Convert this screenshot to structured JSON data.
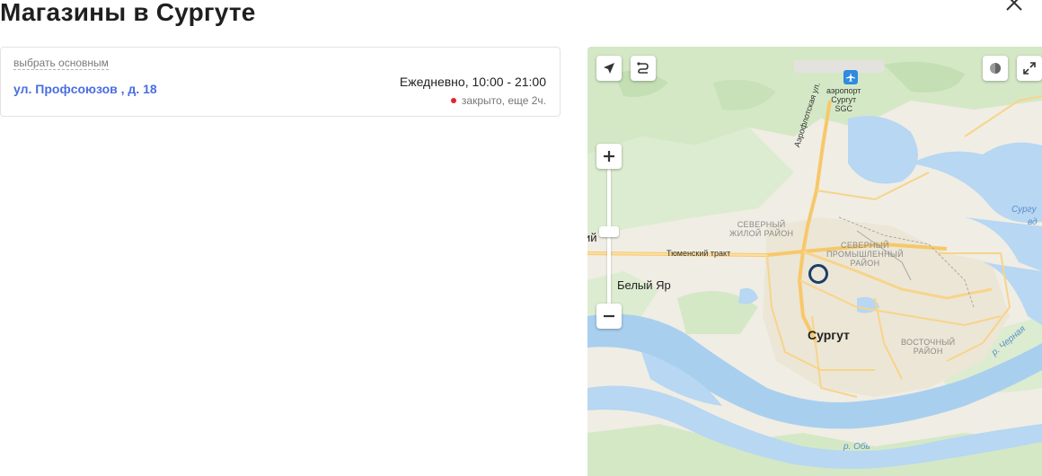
{
  "header": {
    "title": "Магазины в Сургуте"
  },
  "store": {
    "set_main_label": "выбрать основным",
    "address": "ул. Профсоюзов , д. 18",
    "hours": "Ежедневно, 10:00 - 21:00",
    "status_text": "закрыто, еще 2ч.",
    "status_color": "#e0262b",
    "link_color": "#4a6ee0"
  },
  "map": {
    "labels": {
      "airport_line1": "аэропорт",
      "airport_line2": "Сургут",
      "airport_line3": "SGC",
      "street_aeroflot": "Аэрофлотская ул.",
      "street_tyumen": "Тюменский тракт",
      "district_north_res_1": "СЕВЕРНЫЙ",
      "district_north_res_2": "ЖИЛОЙ РАЙОН",
      "district_north_ind_1": "СЕВЕРНЫЙ",
      "district_north_ind_2": "ПРОМЫШЛЕННЫЙ",
      "district_north_ind_3": "РАЙОН",
      "district_east_1": "ВОСТОЧНЫЙ",
      "district_east_2": "РАЙОН",
      "city": "Сургут",
      "town_bely_yar": "Белый Яр",
      "partial_left": "ий",
      "water_surgut_1": "Сургу",
      "water_surgut_2": "вд",
      "river_ob": "р. Обь",
      "river_chernaya": "р. Черная"
    },
    "controls": [
      "location-icon",
      "route-icon",
      "zoom-in-icon",
      "zoom-out-icon",
      "layers-icon",
      "fullscreen-icon"
    ]
  }
}
